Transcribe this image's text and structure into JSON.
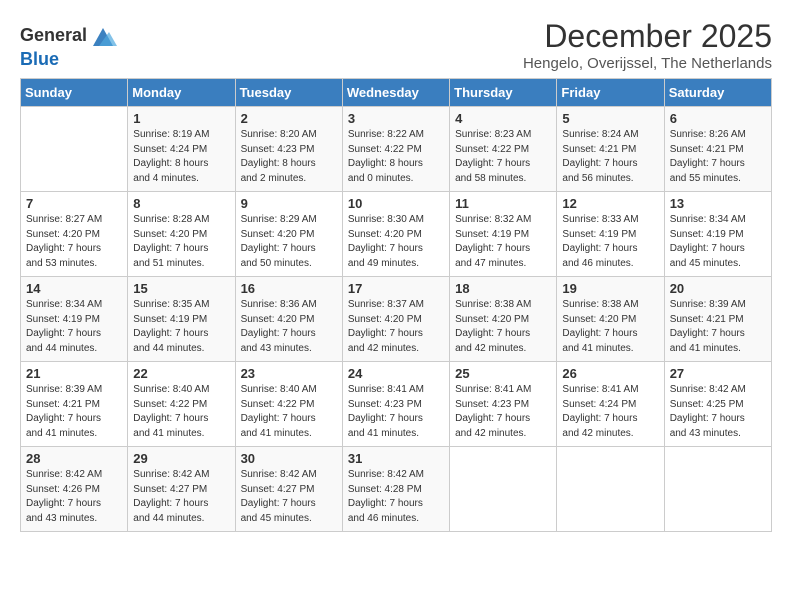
{
  "logo": {
    "text_general": "General",
    "text_blue": "Blue"
  },
  "title": "December 2025",
  "location": "Hengelo, Overijssel, The Netherlands",
  "days_of_week": [
    "Sunday",
    "Monday",
    "Tuesday",
    "Wednesday",
    "Thursday",
    "Friday",
    "Saturday"
  ],
  "weeks": [
    [
      {
        "day": "",
        "info": ""
      },
      {
        "day": "1",
        "info": "Sunrise: 8:19 AM\nSunset: 4:24 PM\nDaylight: 8 hours\nand 4 minutes."
      },
      {
        "day": "2",
        "info": "Sunrise: 8:20 AM\nSunset: 4:23 PM\nDaylight: 8 hours\nand 2 minutes."
      },
      {
        "day": "3",
        "info": "Sunrise: 8:22 AM\nSunset: 4:22 PM\nDaylight: 8 hours\nand 0 minutes."
      },
      {
        "day": "4",
        "info": "Sunrise: 8:23 AM\nSunset: 4:22 PM\nDaylight: 7 hours\nand 58 minutes."
      },
      {
        "day": "5",
        "info": "Sunrise: 8:24 AM\nSunset: 4:21 PM\nDaylight: 7 hours\nand 56 minutes."
      },
      {
        "day": "6",
        "info": "Sunrise: 8:26 AM\nSunset: 4:21 PM\nDaylight: 7 hours\nand 55 minutes."
      }
    ],
    [
      {
        "day": "7",
        "info": "Sunrise: 8:27 AM\nSunset: 4:20 PM\nDaylight: 7 hours\nand 53 minutes."
      },
      {
        "day": "8",
        "info": "Sunrise: 8:28 AM\nSunset: 4:20 PM\nDaylight: 7 hours\nand 51 minutes."
      },
      {
        "day": "9",
        "info": "Sunrise: 8:29 AM\nSunset: 4:20 PM\nDaylight: 7 hours\nand 50 minutes."
      },
      {
        "day": "10",
        "info": "Sunrise: 8:30 AM\nSunset: 4:20 PM\nDaylight: 7 hours\nand 49 minutes."
      },
      {
        "day": "11",
        "info": "Sunrise: 8:32 AM\nSunset: 4:19 PM\nDaylight: 7 hours\nand 47 minutes."
      },
      {
        "day": "12",
        "info": "Sunrise: 8:33 AM\nSunset: 4:19 PM\nDaylight: 7 hours\nand 46 minutes."
      },
      {
        "day": "13",
        "info": "Sunrise: 8:34 AM\nSunset: 4:19 PM\nDaylight: 7 hours\nand 45 minutes."
      }
    ],
    [
      {
        "day": "14",
        "info": "Sunrise: 8:34 AM\nSunset: 4:19 PM\nDaylight: 7 hours\nand 44 minutes."
      },
      {
        "day": "15",
        "info": "Sunrise: 8:35 AM\nSunset: 4:19 PM\nDaylight: 7 hours\nand 44 minutes."
      },
      {
        "day": "16",
        "info": "Sunrise: 8:36 AM\nSunset: 4:20 PM\nDaylight: 7 hours\nand 43 minutes."
      },
      {
        "day": "17",
        "info": "Sunrise: 8:37 AM\nSunset: 4:20 PM\nDaylight: 7 hours\nand 42 minutes."
      },
      {
        "day": "18",
        "info": "Sunrise: 8:38 AM\nSunset: 4:20 PM\nDaylight: 7 hours\nand 42 minutes."
      },
      {
        "day": "19",
        "info": "Sunrise: 8:38 AM\nSunset: 4:20 PM\nDaylight: 7 hours\nand 41 minutes."
      },
      {
        "day": "20",
        "info": "Sunrise: 8:39 AM\nSunset: 4:21 PM\nDaylight: 7 hours\nand 41 minutes."
      }
    ],
    [
      {
        "day": "21",
        "info": "Sunrise: 8:39 AM\nSunset: 4:21 PM\nDaylight: 7 hours\nand 41 minutes."
      },
      {
        "day": "22",
        "info": "Sunrise: 8:40 AM\nSunset: 4:22 PM\nDaylight: 7 hours\nand 41 minutes."
      },
      {
        "day": "23",
        "info": "Sunrise: 8:40 AM\nSunset: 4:22 PM\nDaylight: 7 hours\nand 41 minutes."
      },
      {
        "day": "24",
        "info": "Sunrise: 8:41 AM\nSunset: 4:23 PM\nDaylight: 7 hours\nand 41 minutes."
      },
      {
        "day": "25",
        "info": "Sunrise: 8:41 AM\nSunset: 4:23 PM\nDaylight: 7 hours\nand 42 minutes."
      },
      {
        "day": "26",
        "info": "Sunrise: 8:41 AM\nSunset: 4:24 PM\nDaylight: 7 hours\nand 42 minutes."
      },
      {
        "day": "27",
        "info": "Sunrise: 8:42 AM\nSunset: 4:25 PM\nDaylight: 7 hours\nand 43 minutes."
      }
    ],
    [
      {
        "day": "28",
        "info": "Sunrise: 8:42 AM\nSunset: 4:26 PM\nDaylight: 7 hours\nand 43 minutes."
      },
      {
        "day": "29",
        "info": "Sunrise: 8:42 AM\nSunset: 4:27 PM\nDaylight: 7 hours\nand 44 minutes."
      },
      {
        "day": "30",
        "info": "Sunrise: 8:42 AM\nSunset: 4:27 PM\nDaylight: 7 hours\nand 45 minutes."
      },
      {
        "day": "31",
        "info": "Sunrise: 8:42 AM\nSunset: 4:28 PM\nDaylight: 7 hours\nand 46 minutes."
      },
      {
        "day": "",
        "info": ""
      },
      {
        "day": "",
        "info": ""
      },
      {
        "day": "",
        "info": ""
      }
    ]
  ]
}
